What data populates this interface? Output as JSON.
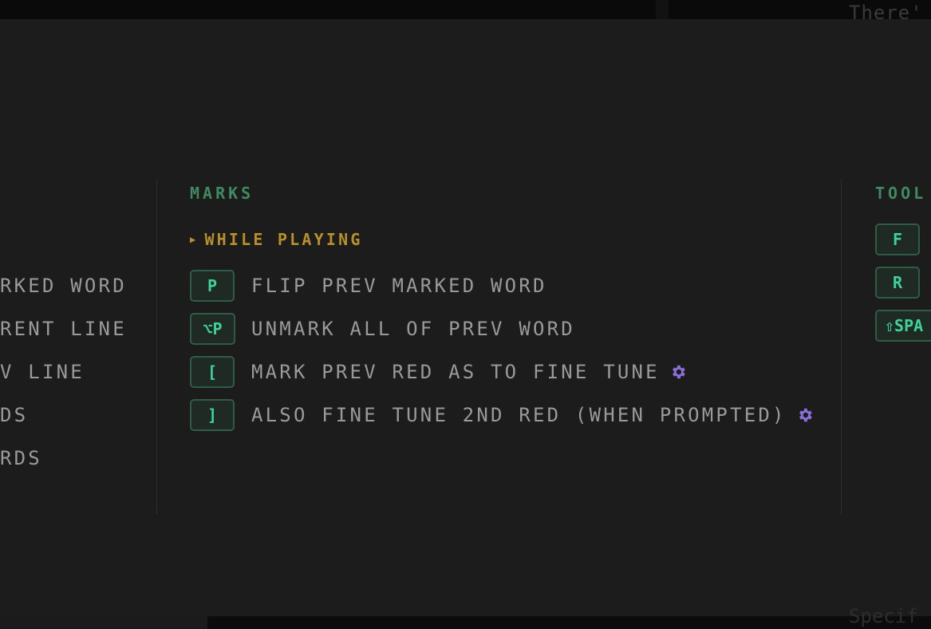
{
  "background": {
    "top_text": "There'",
    "bottom_text": "Specif"
  },
  "left_column": {
    "rows": [
      "RKED WORD",
      "RENT LINE",
      "V LINE",
      "DS",
      "RDS"
    ]
  },
  "marks": {
    "title": "MARKS",
    "subsection": "WHILE PLAYING",
    "rows": [
      {
        "key": "P",
        "label": "FLIP PREV MARKED WORD",
        "gear": false
      },
      {
        "key": "⌥P",
        "label": "UNMARK ALL OF PREV WORD",
        "gear": false
      },
      {
        "key": "[",
        "label": "MARK PREV RED AS TO FINE TUNE",
        "gear": true
      },
      {
        "key": "]",
        "label": "ALSO FINE TUNE 2ND RED (WHEN PROMPTED)",
        "gear": true
      }
    ]
  },
  "tools": {
    "title": "TOOL",
    "keys": [
      "F",
      "R",
      "⇧SPA"
    ]
  },
  "colors": {
    "section_title": "#3f8a5f",
    "subsection": "#b8902a",
    "key_text": "#3ed39a",
    "gear": "#8a6fd8"
  }
}
